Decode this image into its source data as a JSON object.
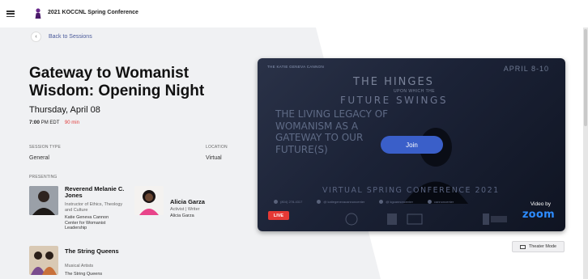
{
  "header": {
    "title": "2021 KOCCNL Spring Conference"
  },
  "back_link": "Back to Sessions",
  "session": {
    "title": "Gateway to Womanist Wisdom: Opening Night",
    "date": "Thursday, April 08",
    "time": "7:00",
    "timezone": "PM EDT",
    "duration": "90 min",
    "session_type_label": "SESSION TYPE",
    "session_type": "General",
    "location_label": "LOCATION",
    "location": "Virtual",
    "presenting_label": "PRESENTING"
  },
  "presenters": [
    {
      "name": "Reverend Melanie C. Jones",
      "role": "Instructor of Ethics, Theology and Culture",
      "org": "Katie Geneva Cannon Center for Womanist Leadership"
    },
    {
      "name": "Alicia Garza",
      "role": "Activist | Writer",
      "org": "Alicia Garza"
    },
    {
      "name": "The String Queens",
      "role": "Musical Artists",
      "org": "The String Queens"
    }
  ],
  "video": {
    "top_text": "THE KATIE GENEVA CANNON",
    "date_text": "APRIL 8-10",
    "headline_1": "THE HINGES",
    "headline_2": "UPON WHICH THE",
    "headline_3": "FUTURE SWINGS",
    "legacy": "THE LIVING LEGACY OF WOMANISM AS A GATEWAY TO OUR FUTURE(S)",
    "virtual": "VIRTUAL SPRING CONFERENCE 2021",
    "contacts": [
      "(804) 278-4317",
      "@ katiegenevacannoncenter",
      "@ kgcannoncenter",
      "cannoncenter"
    ],
    "join_label": "Join",
    "live_label": "LIVE",
    "video_by": "Video by",
    "zoom": "zoom"
  },
  "theater_mode": "Theater Mode",
  "colors": {
    "accent": "#3a5fc9",
    "live": "#e53935",
    "duration": "#e03a3a",
    "zoom": "#2d8cff"
  }
}
